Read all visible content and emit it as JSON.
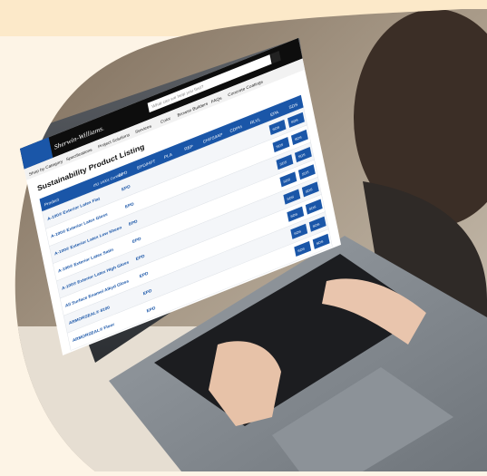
{
  "site": {
    "brand": "Sherwin-Williams.",
    "search_placeholder": "What can we help you find?",
    "nav_items": [
      "Shop by Category",
      "Specifications",
      "Project Solutions",
      "Services",
      "Color",
      "Browse Builders",
      "FAQs",
      "Concrete Coatings"
    ],
    "page_title": "Sustainability Product Listing"
  },
  "table": {
    "headers": [
      "Product",
      "ISO 14001 Certified",
      "EPD",
      "EPD/HPT",
      "PLA",
      "REP",
      "CHPS/IAP",
      "CDPH",
      "RLVL",
      "EPA",
      "SDS"
    ],
    "rows": [
      {
        "product": "A-100® Exterior Latex Flat",
        "epd": "EPD"
      },
      {
        "product": "A-100® Exterior Latex Gloss",
        "epd": "EPD"
      },
      {
        "product": "A-100® Exterior Latex Low Sheen",
        "epd": "EPD"
      },
      {
        "product": "A-100® Exterior Latex Satin",
        "epd": "EPD"
      },
      {
        "product": "A-100® Exterior Latex High Gloss",
        "epd": "EPD"
      },
      {
        "product": "All Surface Enamel Alkyd Gloss",
        "epd": "EPD"
      },
      {
        "product": "ARMORSEAL® 8100",
        "epd": "EPD"
      },
      {
        "product": "ARMORSEAL® Floor",
        "epd": "EPD"
      }
    ],
    "button_label": "SDS"
  },
  "colors": {
    "brand_blue": "#1a56a8",
    "header_dark": "#0d0d0d",
    "background": "#fdf4e6"
  }
}
